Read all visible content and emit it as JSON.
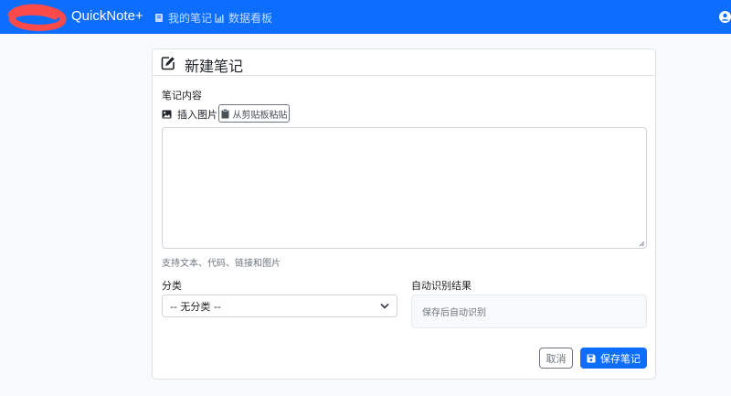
{
  "navbar": {
    "brand": "QuickNote+",
    "links": [
      {
        "label": "我的笔记",
        "icon": "notes-icon"
      },
      {
        "label": "数据看板",
        "icon": "bar-chart-icon"
      }
    ],
    "user_icon": "user-circle-icon",
    "bg_color": "#0d6efd"
  },
  "card": {
    "title": "新建笔记",
    "title_icon": "pencil-square-icon",
    "content_label": "笔记内容",
    "insert_image_label": "插入图片",
    "paste_button_label": "从剪贴板粘贴",
    "textarea_value": "",
    "help_text": "支持文本、代码、链接和图片",
    "category_label": "分类",
    "category_selected": "-- 无分类 --",
    "auto_label": "自动识别结果",
    "auto_placeholder": "保存后自动识别",
    "cancel_label": "取消",
    "save_label": "保存笔记",
    "accent_color": "#0d6efd"
  }
}
